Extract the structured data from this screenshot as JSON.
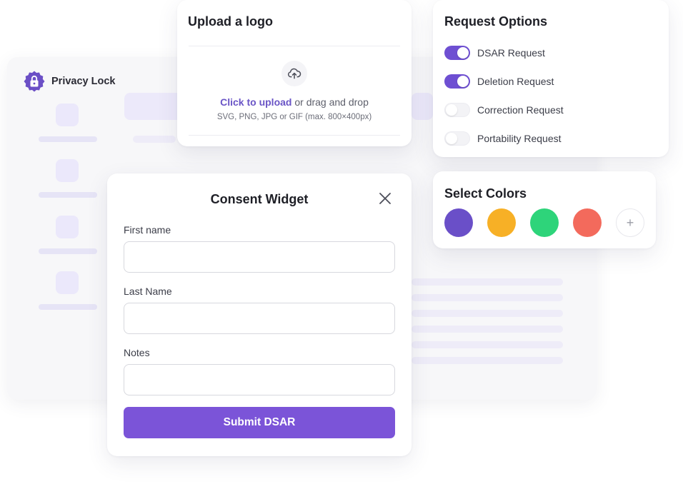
{
  "brand": {
    "name": "Privacy Lock",
    "logo_icon": "lock-badge-icon"
  },
  "upload": {
    "title": "Upload a logo",
    "icon": "upload-cloud-icon",
    "link_text": "Click to upload",
    "rest_text": " or drag and drop",
    "hint": "SVG, PNG, JPG or GIF (max. 800×400px)"
  },
  "request_options": {
    "title": "Request Options",
    "items": [
      {
        "label": "DSAR Request",
        "on": true
      },
      {
        "label": "Deletion Request",
        "on": true
      },
      {
        "label": "Correction Request",
        "on": false
      },
      {
        "label": "Portability Request",
        "on": false
      }
    ],
    "accent_color": "#6e4fd2"
  },
  "colors": {
    "title": "Select Colors",
    "swatches": [
      "#6a4fc8",
      "#f7b026",
      "#2ed47a",
      "#f36a5c"
    ],
    "add_label": "+"
  },
  "consent": {
    "title": "Consent Widget",
    "close_icon": "close-icon",
    "fields": [
      {
        "label": "First name",
        "value": "",
        "placeholder": ""
      },
      {
        "label": "Last Name",
        "value": "",
        "placeholder": ""
      },
      {
        "label": "Notes",
        "value": "",
        "placeholder": ""
      }
    ],
    "submit_label": "Submit DSAR",
    "submit_color": "#7b54d8"
  }
}
